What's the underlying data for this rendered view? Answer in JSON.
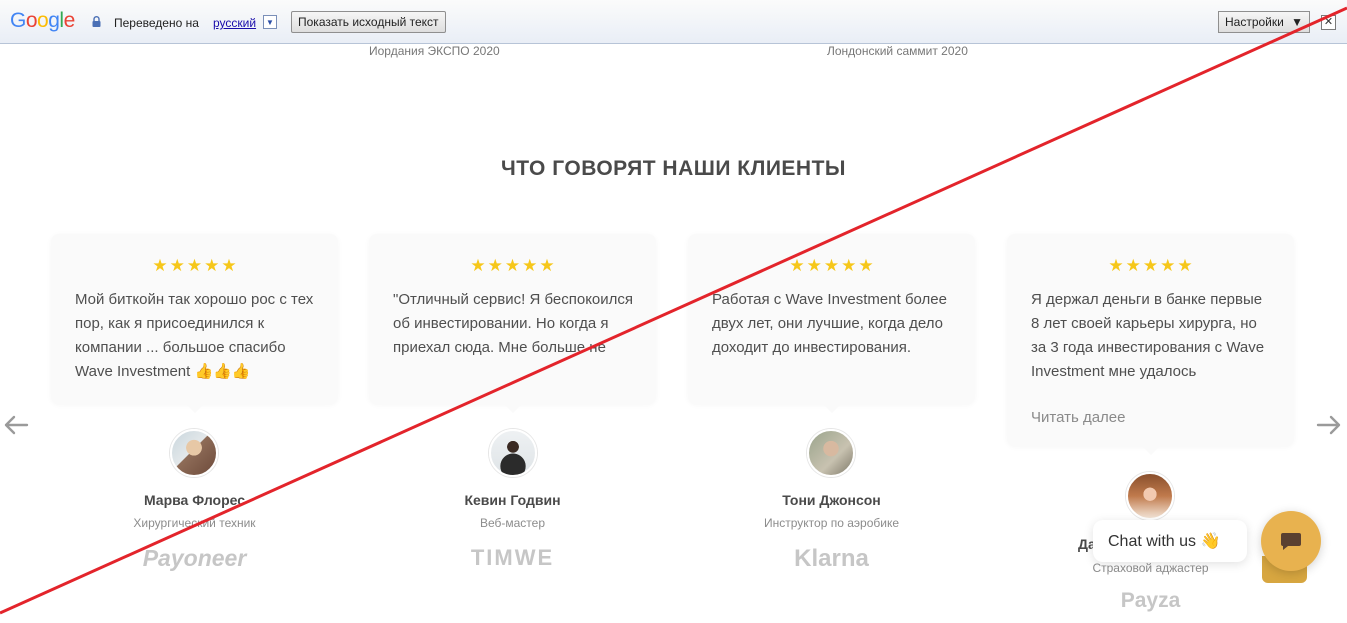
{
  "translate_bar": {
    "logo": "Google",
    "translated_to": "Переведено на",
    "language": "русский",
    "dropdown_glyph": "▼",
    "show_original": "Показать исходный текст",
    "settings": "Настройки",
    "settings_arrow": "▼",
    "close": "✕"
  },
  "events": {
    "left": "Иордания ЭКСПО 2020",
    "right": "Лондонский саммит 2020"
  },
  "section_title": "ЧТО ГОВОРЯТ НАШИ КЛИЕНТЫ",
  "stars": "★★★★★",
  "testimonials": [
    {
      "quote": "Мой биткойн так хорошо рос с тех пор, как я присоединился к компании ... большое спасибо Wave Investment 👍👍👍",
      "name": "Марва Флорес",
      "role": "Хирургический техник",
      "brand": "Payoneer",
      "rating": 5
    },
    {
      "quote": "\"Отличный сервис! Я беспокоился об инвестировании. Но когда я приехал сюда. Мне больше не",
      "name": "Кевин Годвин",
      "role": "Веб-мастер",
      "brand": "TIMWE",
      "rating": 5
    },
    {
      "quote": "Работая с Wave Investment более двух лет, они лучшие, когда дело доходит до инвестирования.",
      "name": "Тони Джонсон",
      "role": "Инструктор по аэробике",
      "brand": "Klarna",
      "rating": 5
    },
    {
      "quote": "Я держал деньги в банке первые 8 лет своей карьеры хирурга, но за 3 года инвестирования с Wave Investment мне удалось",
      "read_more": "Читать далее",
      "name": "Да",
      "role": "Страховой аджастер",
      "brand": "Payza",
      "rating": 5
    }
  ],
  "chat": {
    "label": "Chat with us 👋"
  },
  "icons": {
    "prev": "arrow-left-icon",
    "next": "arrow-right-icon",
    "chat": "chat-icon",
    "lock": "lock-icon"
  },
  "colors": {
    "star": "#f6c71a",
    "chat_button": "#e8b24f",
    "strike_line": "#e3242b"
  }
}
